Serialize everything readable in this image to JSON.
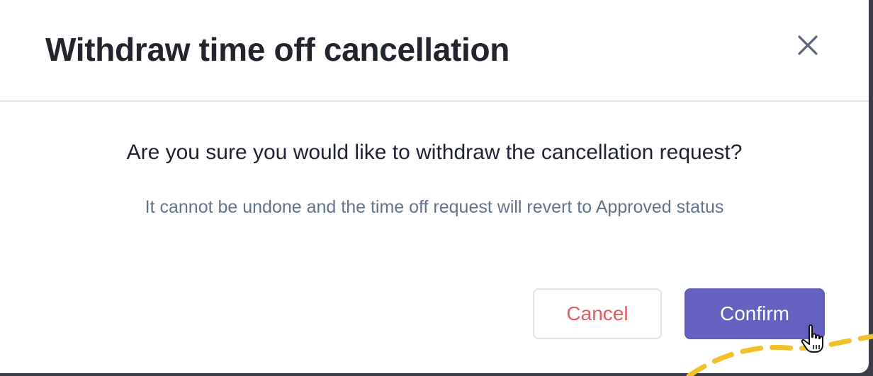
{
  "dialog": {
    "title": "Withdraw time off cancellation",
    "close_icon": "close-icon",
    "question": "Are you sure you would like to withdraw the cancellation request?",
    "subtext": "It cannot be undone and the time off request will revert to Approved status"
  },
  "actions": {
    "cancel_label": "Cancel",
    "confirm_label": "Confirm"
  },
  "colors": {
    "title": "#22252d",
    "question": "#1e2233",
    "subtext": "#62738e",
    "cancel_text": "#e35d5d",
    "confirm_bg": "#6561c0",
    "annotation_dash": "#f2c028"
  },
  "cursor_icon": "hand-pointer-icon"
}
